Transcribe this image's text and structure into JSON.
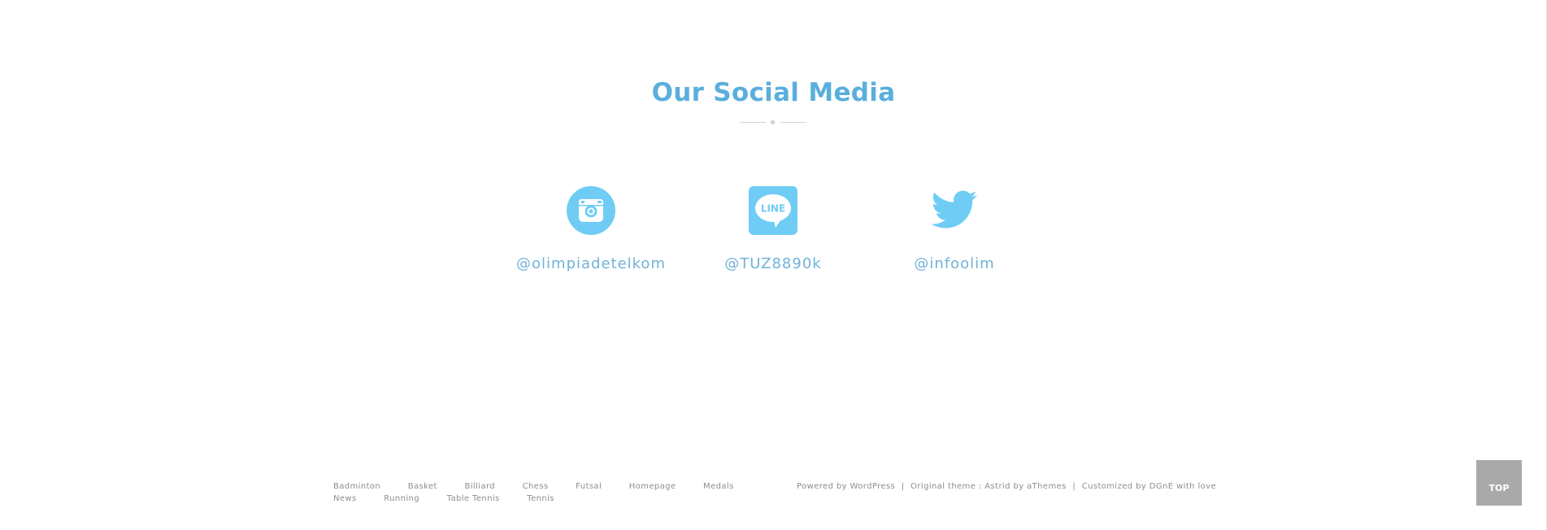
{
  "section": {
    "title": "Our Social Media"
  },
  "social": [
    {
      "platform": "instagram",
      "icon": "instagram-icon",
      "handle": "@olimpiadetelkom"
    },
    {
      "platform": "line",
      "icon": "line-icon",
      "icon_text": "LINE",
      "handle": "@TUZ8890k"
    },
    {
      "platform": "twitter",
      "icon": "twitter-icon",
      "handle": "@infoolim"
    }
  ],
  "footer": {
    "menu_row1": [
      "Badminton",
      "Basket",
      "Billiard",
      "Chess",
      "Futsal",
      "Homepage",
      "Medals"
    ],
    "menu_row2": [
      "News",
      "Running",
      "Table Tennis",
      "Tennis"
    ],
    "credit": {
      "powered": "Powered by WordPress",
      "sep": "|",
      "theme": "Original theme : Astrid by aThemes",
      "custom": "Customized by DGnE with love"
    }
  },
  "top_button": {
    "label": "TOP"
  },
  "colors": {
    "accent": "#5aafdc",
    "icon": "#6fcdf5",
    "handle": "#6fb3d8",
    "footer_text": "#8d8d8d",
    "top_button_bg": "#a9a9a9"
  }
}
